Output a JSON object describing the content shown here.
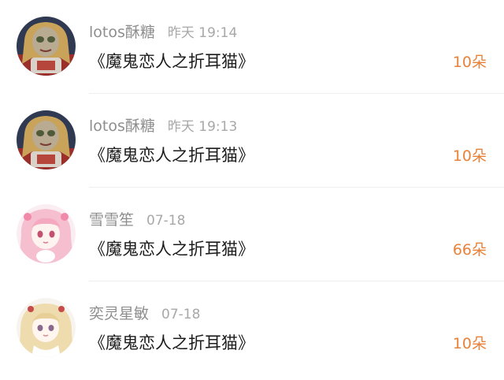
{
  "records": [
    {
      "avatar": "doll-girl-avatar",
      "username": "lotos酥糖",
      "time": "昨天 19:14",
      "gift": "《魔鬼恋人之折耳猫》",
      "amount": "10朵"
    },
    {
      "avatar": "doll-girl-avatar",
      "username": "lotos酥糖",
      "time": "昨天 19:13",
      "gift": "《魔鬼恋人之折耳猫》",
      "amount": "10朵"
    },
    {
      "avatar": "pink-hair-anime-avatar",
      "username": "雪雪笙",
      "time": "07-18",
      "gift": "《魔鬼恋人之折耳猫》",
      "amount": "66朵"
    },
    {
      "avatar": "blonde-anime-avatar",
      "username": "奕灵星敏",
      "time": "07-18",
      "gift": "《魔鬼恋人之折耳猫》",
      "amount": "10朵"
    }
  ],
  "colors": {
    "username": "#8e8e8e",
    "time": "#a8a8a8",
    "title": "#1c1c1c",
    "amount": "#e8823a",
    "divider": "#eeeeee"
  }
}
